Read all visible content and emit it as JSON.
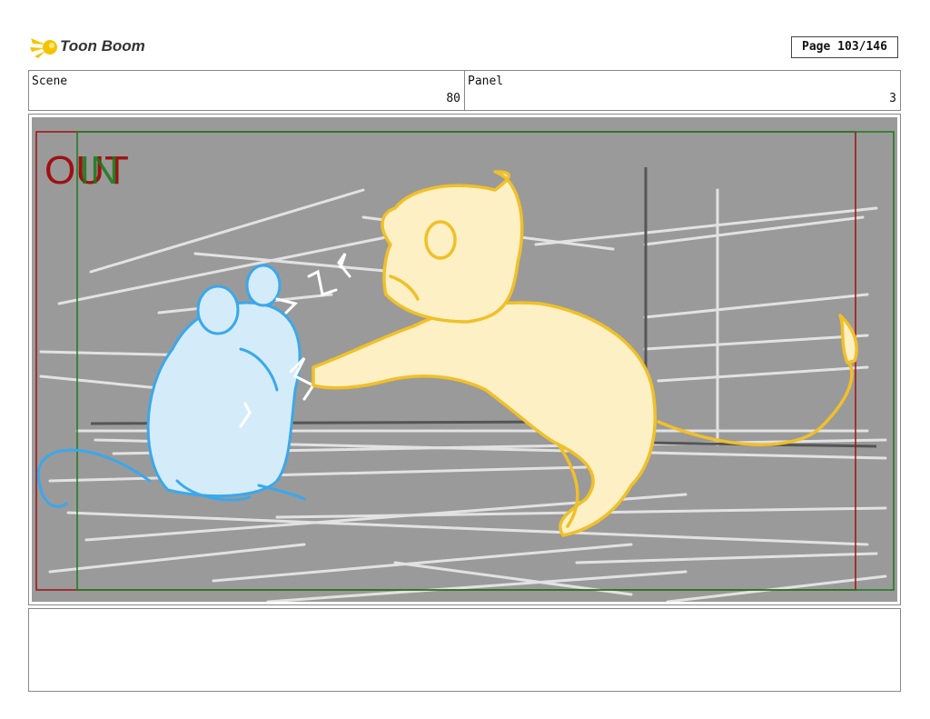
{
  "header": {
    "brand": "Toon Boom",
    "logo_icon": "comet-icon",
    "page_label": "Page 103/146"
  },
  "info": {
    "scene_label": "Scene",
    "scene_value": "80",
    "panel_label": "Panel",
    "panel_value": "3"
  },
  "panel": {
    "out_label": "OUT",
    "in_label": "IN",
    "colors": {
      "background": "#9a9a9a",
      "out_frame": "#a01010",
      "in_frame": "#1a7a1a",
      "mouse_fill": "#d4ecf9",
      "mouse_stroke": "#3aa8ec",
      "lion_fill": "#fdf0c4",
      "lion_stroke": "#f0c02a"
    }
  },
  "notes": {
    "text": ""
  }
}
